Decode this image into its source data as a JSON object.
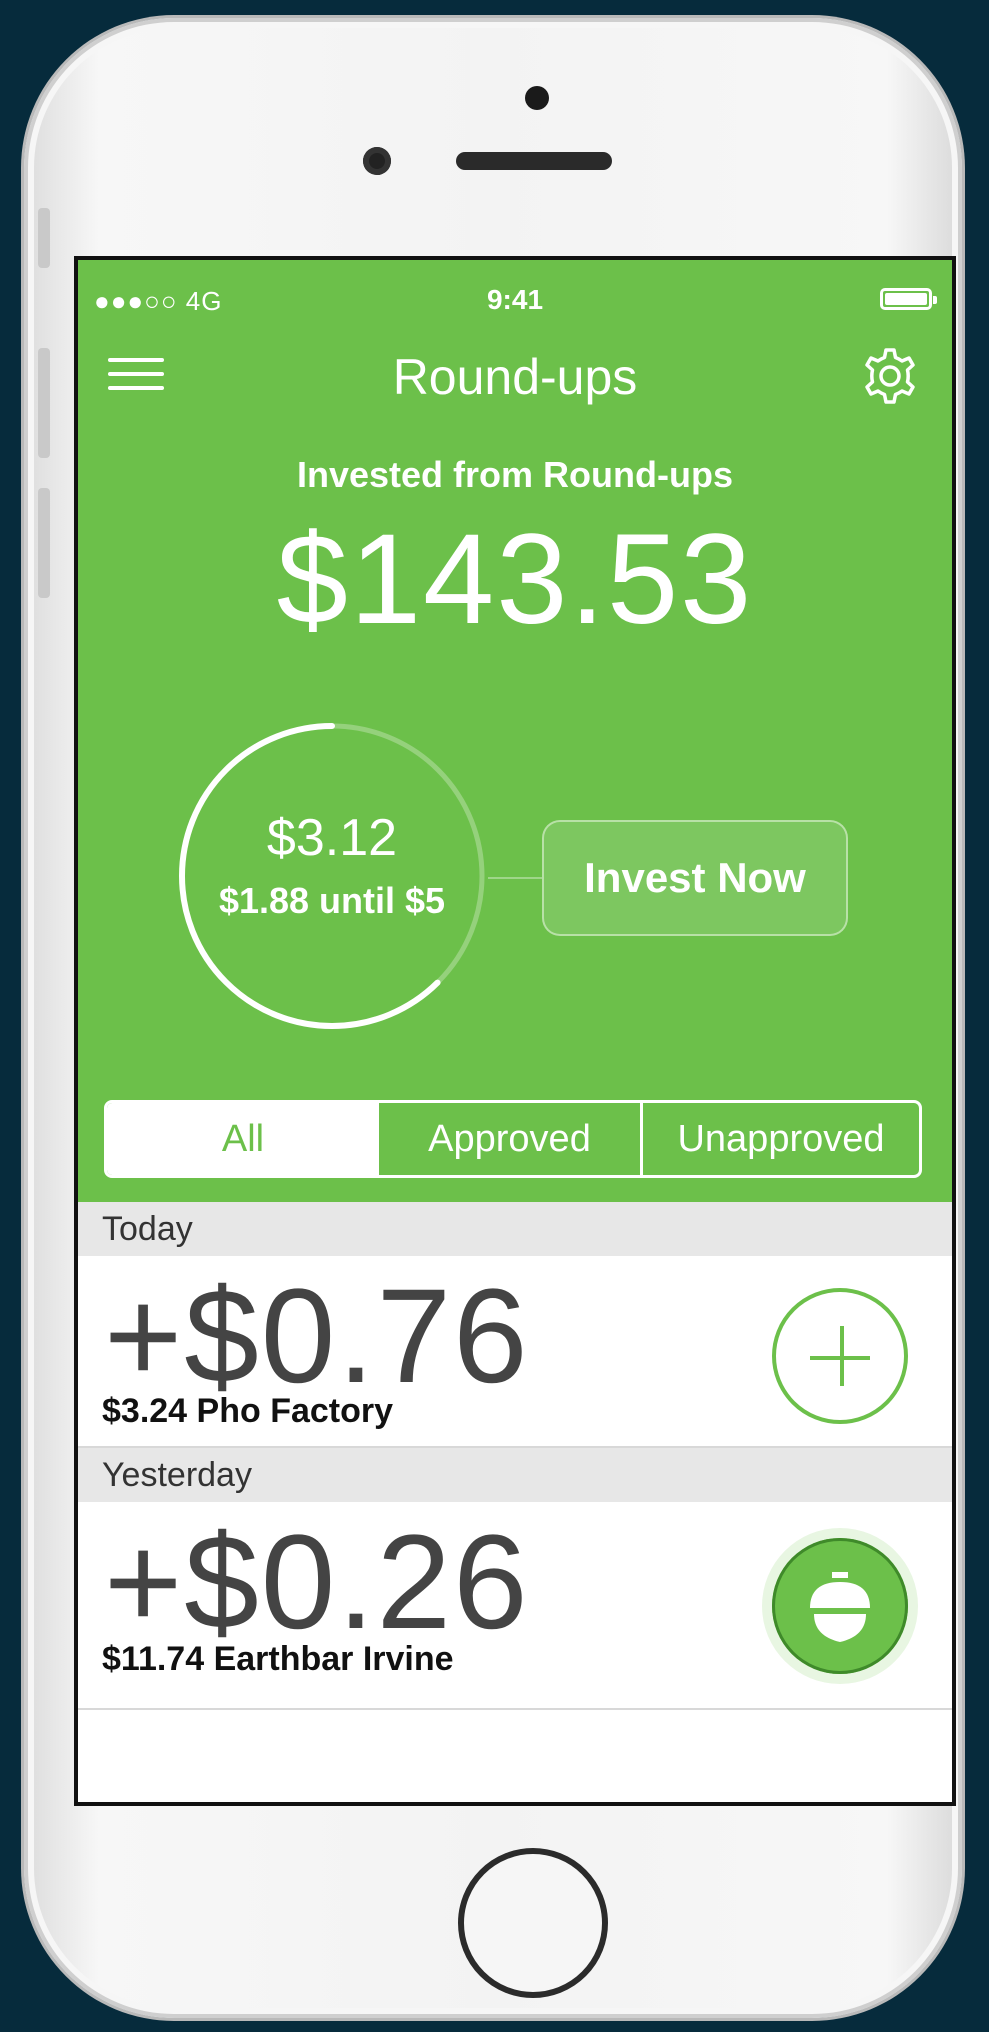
{
  "status_bar": {
    "signal": "●●●○○ 4G",
    "time": "9:41"
  },
  "nav": {
    "title": "Round-ups",
    "menu_icon": "hamburger-menu-icon",
    "settings_icon": "gear-icon"
  },
  "summary": {
    "label": "Invested from Round-ups",
    "amount": "$143.53"
  },
  "progress": {
    "current": "$3.12",
    "until": "$1.88 until $5",
    "fraction": 0.624
  },
  "invest_button": {
    "label": "Invest Now"
  },
  "filters": {
    "tabs": [
      "All",
      "Approved",
      "Unapproved"
    ],
    "selected": "All"
  },
  "sections": [
    {
      "title": "Today",
      "items": [
        {
          "amount": "+$0.76",
          "description": "$3.24 Pho Factory",
          "action": "add"
        }
      ]
    },
    {
      "title": "Yesterday",
      "items": [
        {
          "amount": "+$0.26",
          "description": "$11.74 Earthbar Irvine",
          "action": "acorn"
        }
      ]
    }
  ],
  "colors": {
    "brand_green": "#6cc04a",
    "background": "#062b3c"
  }
}
